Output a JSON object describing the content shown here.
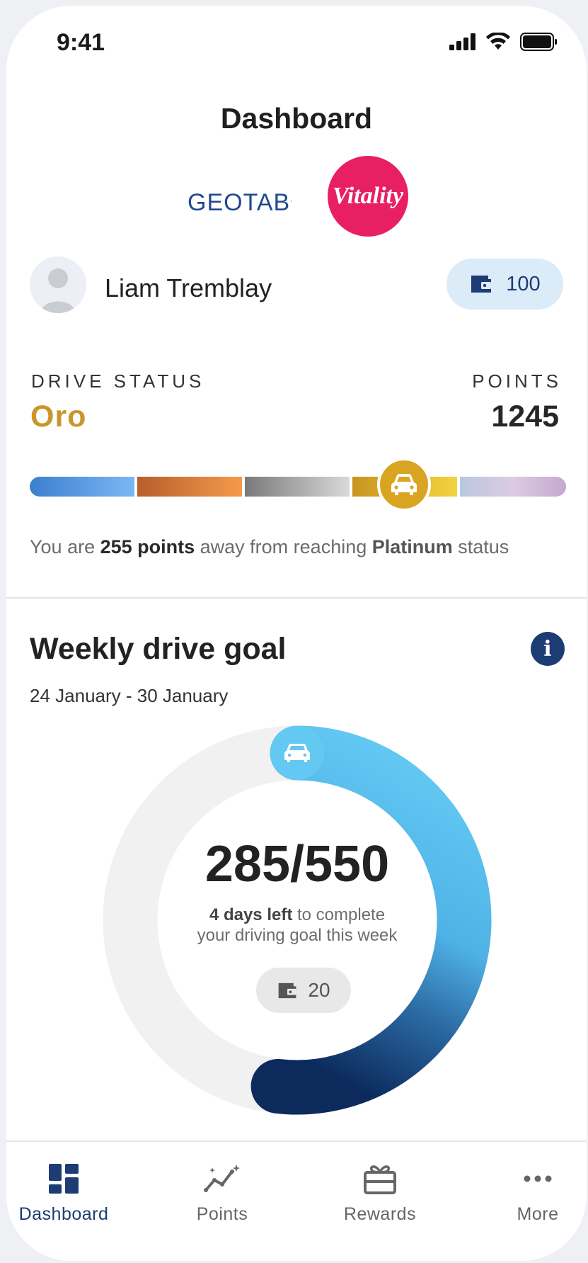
{
  "status_bar": {
    "time": "9:41"
  },
  "header": {
    "title": "Dashboard"
  },
  "brands": {
    "partner_logo": "GEOTAB",
    "program_logo": "Vitality"
  },
  "user": {
    "name": "Liam Tremblay",
    "wallet_points": "100"
  },
  "drive_status": {
    "label": "DRIVE STATUS",
    "value": "Oro",
    "points_label": "POINTS",
    "points_value": "1245",
    "away_prefix": "You are ",
    "away_points": "255 points",
    "away_middle": " away from reaching ",
    "away_tier": "Platinum",
    "away_suffix": " status"
  },
  "weekly_goal": {
    "title": "Weekly drive goal",
    "date_range": "24 January - 30 January",
    "progress_text": "285/550",
    "progress_current": 285,
    "progress_target": 550,
    "days_left": "4 days left",
    "days_left_suffix": " to complete your driving goal this week",
    "reward_points": "20"
  },
  "tabs": [
    {
      "label": "Dashboard",
      "icon": "dashboard-icon",
      "active": true
    },
    {
      "label": "Points",
      "icon": "points-icon",
      "active": false
    },
    {
      "label": "Rewards",
      "icon": "rewards-icon",
      "active": false
    },
    {
      "label": "More",
      "icon": "more-icon",
      "active": false
    }
  ],
  "colors": {
    "primary": "#1d3c74",
    "oro": "#c8962b",
    "vitality": "#e91f63",
    "ring_light": "#63c9f3",
    "ring_dark": "#0c2a5c"
  }
}
